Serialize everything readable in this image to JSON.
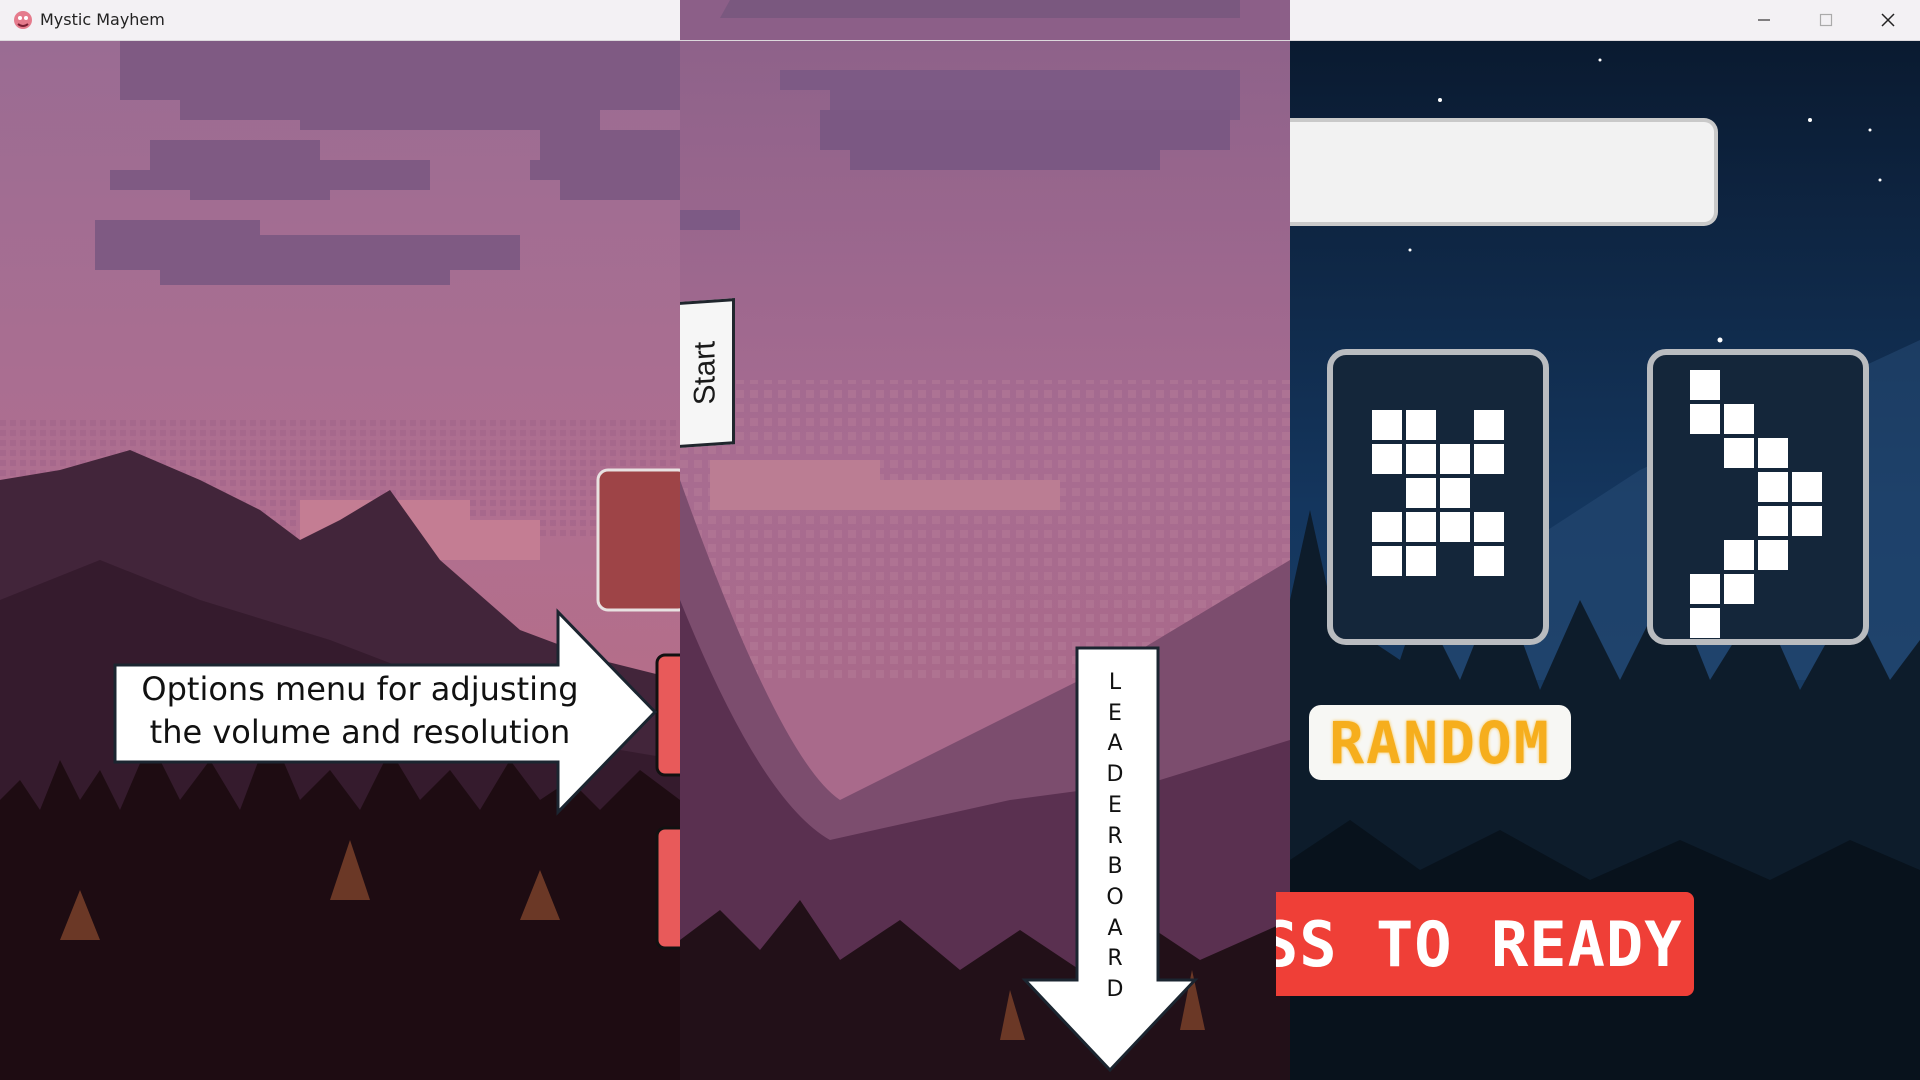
{
  "window": {
    "title": "Mystic Mayhem",
    "app_icon": "mystic-mayhem-app-icon",
    "controls": [
      "minimize-icon",
      "maximize-icon",
      "close-icon"
    ]
  },
  "panels": {
    "left": {
      "annotation": "Options menu for adjusting the volume and resolution",
      "annotation_line1": "Options menu for adjusting",
      "annotation_line2": "the volume and resolution"
    },
    "middle": {
      "start_label": "Start",
      "leaderboard_letters": [
        "L",
        "E",
        "A",
        "D",
        "E",
        "R",
        "B",
        "O",
        "A",
        "R",
        "D"
      ]
    },
    "right": {
      "name_field_value": "",
      "character_left_glyph": "X",
      "character_right_glyph": ")",
      "random_label": "RANDOM",
      "ready_label": "PRESS TO READY",
      "ready_label_visible": "ESS TO READY"
    }
  },
  "colors": {
    "sky": "#a8698f",
    "mountain": "#3f2236",
    "forest": "#1c0b10",
    "ready_button": "#ef3f37",
    "random_text": "#f6ae1d",
    "night_sky": "#0f2340"
  }
}
